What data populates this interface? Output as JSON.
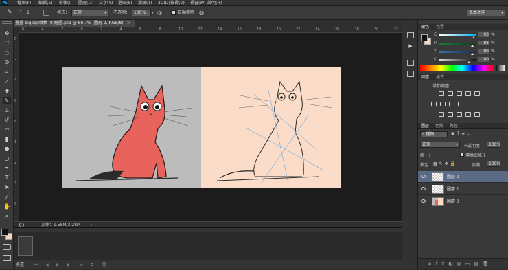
{
  "app": {
    "logo": "Ps"
  },
  "menu": [
    "檔案(F)",
    "編輯(E)",
    "影像(I)",
    "圖層(L)",
    "文字(Y)",
    "選取(S)",
    "濾鏡(T)",
    "3D(D)",
    "檢視(V)",
    "視窗(W)",
    "說明(H)"
  ],
  "options_bar": {
    "brush_size": "1",
    "mode_label": "模式：",
    "mode_value": "正常",
    "opacity_label": "不透明：",
    "opacity_value": "100%",
    "auto_erase_label": "自動擦除",
    "workspace": "基本功能"
  },
  "tools": [
    "move-icon",
    "marquee-icon",
    "lasso-icon",
    "quick-select-icon",
    "crop-icon",
    "eyedropper-icon",
    "healing-icon",
    "brush-icon",
    "stamp-icon",
    "history-brush-icon",
    "eraser-icon",
    "gradient-icon",
    "blur-icon",
    "dodge-icon",
    "pen-icon",
    "type-icon",
    "path-select-icon",
    "line-icon",
    "hand-icon",
    "zoom-icon"
  ],
  "document": {
    "tab_title": "畫畫-bigegg收集 (9)繪圖.psd @ 66.7% (圖層 2, RGB/8)",
    "file_info": "文件：1.58M/3.28M"
  },
  "ruler_h": [
    "6",
    "4",
    "2",
    "0",
    "2",
    "4",
    "6",
    "8",
    "10",
    "12",
    "14",
    "16",
    "18",
    "20",
    "22",
    "24",
    "26",
    "28",
    "30",
    "32"
  ],
  "ruler_v": [
    "0",
    "2",
    "4",
    "6",
    "8",
    "1",
    "2",
    "4",
    "6"
  ],
  "colors": {
    "accent_swatch_fg": "#111111",
    "accent_swatch_bg": "#f6d7c2",
    "canvas_left_bg": "#bcbcbc",
    "canvas_right_bg": "#fbdcc8",
    "cat_fill": "#e8635c"
  },
  "color_panel": {
    "tabs": [
      "顏色",
      "色票"
    ],
    "sliders": [
      {
        "label": "C",
        "value": "93",
        "unit": "%",
        "level": 0.93
      },
      {
        "label": "M",
        "value": "88",
        "unit": "%",
        "level": 0.88
      },
      {
        "label": "Y",
        "value": "89",
        "unit": "%",
        "level": 0.89
      },
      {
        "label": "K",
        "value": "80",
        "unit": "%",
        "level": 0.8
      }
    ]
  },
  "adjustments_panel": {
    "tabs": [
      "調整",
      "樣式"
    ],
    "title": "增加調整"
  },
  "layers_panel": {
    "tabs": [
      "圖層",
      "色版",
      "路徑"
    ],
    "filter_label": "種類",
    "blend_mode": "正常",
    "opacity_label": "不透明度：",
    "opacity_value": "100%",
    "unify_label": "統一：",
    "propagate_label": "傳播影格 1",
    "lock_label": "鎖定：",
    "fill_label": "填滿：",
    "fill_value": "100%",
    "layers": [
      {
        "name": "圖層 2",
        "selected": true
      },
      {
        "name": "圖層 1",
        "selected": false
      },
      {
        "name": "圖層 0",
        "selected": false
      }
    ]
  },
  "timeline": {
    "frame_delay": "永遠"
  }
}
